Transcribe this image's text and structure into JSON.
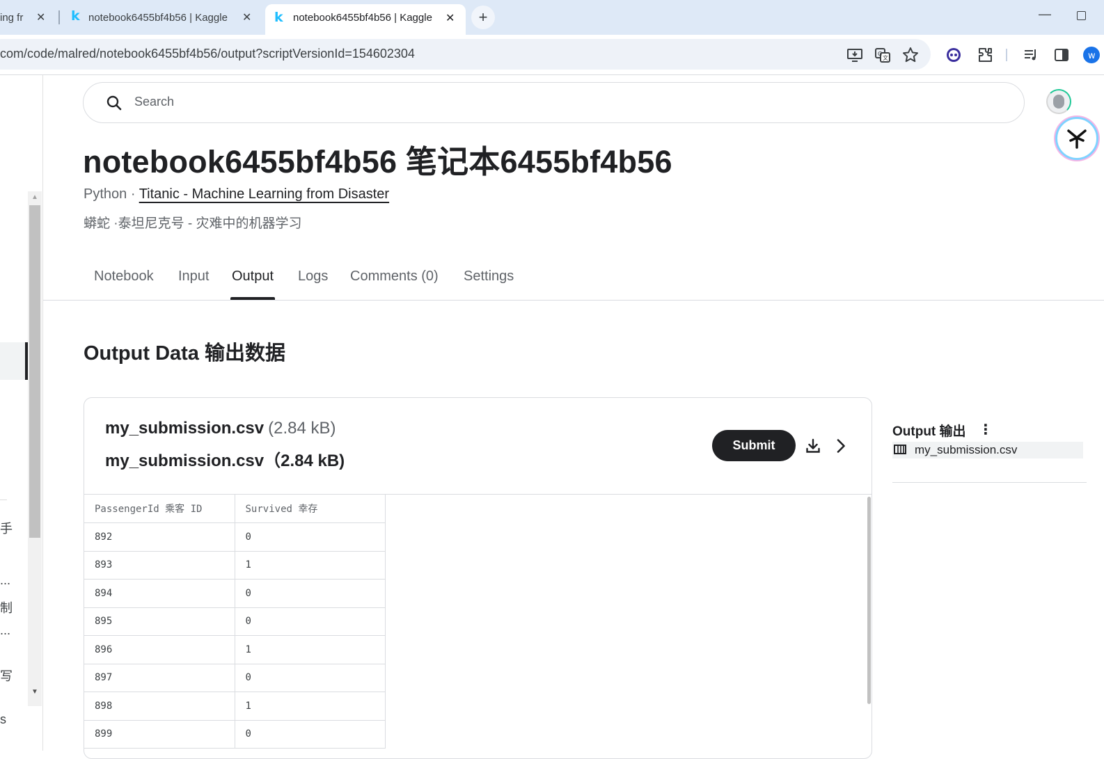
{
  "browser": {
    "tabs": [
      {
        "title": "ing fr"
      },
      {
        "title": "notebook6455bf4b56 | Kaggle"
      },
      {
        "title": "notebook6455bf4b56 | Kaggle"
      }
    ],
    "url": "com/code/malred/notebook6455bf4b56/output?scriptVersionId=154602304",
    "tab_logo": "k"
  },
  "left_rail": {
    "fragments": [
      "手",
      "...",
      "制",
      "...",
      "写",
      "s"
    ]
  },
  "search": {
    "placeholder": "Search"
  },
  "page": {
    "title": "notebook6455bf4b56 笔记本6455bf4b56",
    "language": "Python",
    "separator": " · ",
    "competition": "Titanic - Machine Learning from Disaster",
    "subtitle_cn": "蟒蛇 ·泰坦尼克号 - 灾难中的机器学习"
  },
  "tabs": [
    {
      "label": "Notebook"
    },
    {
      "label": "Input"
    },
    {
      "label": "Output"
    },
    {
      "label": "Logs"
    },
    {
      "label": "Comments (0)"
    },
    {
      "label": "Settings"
    }
  ],
  "output": {
    "section_title": "Output Data 输出数据",
    "file": {
      "name": "my_submission.csv",
      "size": "(2.84 kB)",
      "name_cn_line": "my_submission.csv（2.84 kB)"
    },
    "submit_label": "Submit",
    "table": {
      "columns": [
        "PassengerId 乘客 ID",
        "Survived 幸存"
      ],
      "rows": [
        [
          "892",
          "0"
        ],
        [
          "893",
          "1"
        ],
        [
          "894",
          "0"
        ],
        [
          "895",
          "0"
        ],
        [
          "896",
          "1"
        ],
        [
          "897",
          "0"
        ],
        [
          "898",
          "1"
        ],
        [
          "899",
          "0"
        ]
      ]
    }
  },
  "right_panel": {
    "title": "Output 输出",
    "kebab": "⋮",
    "items": [
      {
        "label": "my_submission.csv",
        "icon": "table-icon"
      }
    ]
  }
}
